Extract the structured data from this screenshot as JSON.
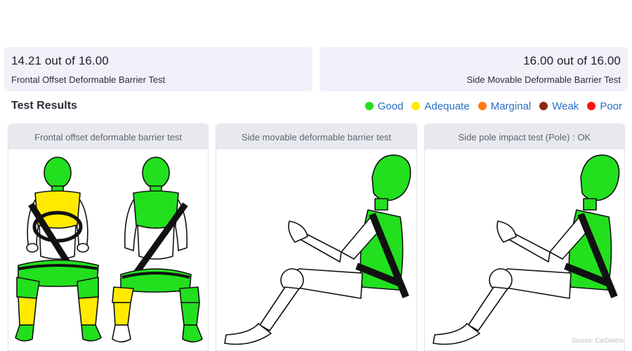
{
  "scores": {
    "frontal": {
      "value": "14.21 out of 16.00",
      "label": "Frontal Offset Deformable Barrier Test"
    },
    "side": {
      "value": "16.00 out of 16.00",
      "label": "Side Movable Deformable Barrier Test"
    }
  },
  "results": {
    "title": "Test Results",
    "legend": [
      {
        "label": "Good",
        "color": "#22e01e"
      },
      {
        "label": "Adequate",
        "color": "#ffea00"
      },
      {
        "label": "Marginal",
        "color": "#ff7a14"
      },
      {
        "label": "Weak",
        "color": "#8b2a12"
      },
      {
        "label": "Poor",
        "color": "#ff1010"
      }
    ]
  },
  "panels": [
    {
      "title": "Frontal offset deformable barrier test"
    },
    {
      "title": "Side movable deformable barrier test"
    },
    {
      "title": "Side pole impact test (Pole) : OK"
    }
  ],
  "colors": {
    "good": "#22e01e",
    "adequate": "#ffea00",
    "outline": "#111111",
    "unrated": "#ffffff"
  },
  "source": "Source: CarDekho"
}
